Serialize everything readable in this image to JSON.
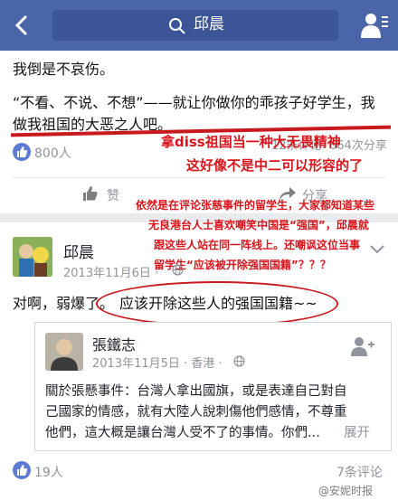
{
  "header": {
    "title": "邱晨"
  },
  "post": {
    "line1": "我倒是不哀伤。",
    "line2": "“不看、不说、不想”——就让你做你的乖孩子好学生，我",
    "line3": "做我祖国的大恶之人吧。",
    "likes": "800人",
    "comments": "12条评论",
    "shares": "664次分享",
    "like_btn": "赞",
    "share_btn": "分享"
  },
  "annotations": {
    "note1": "拿diss祖国当一种大无畏精神",
    "note2": "这好像不是中二可以形容的了",
    "note3_lines": [
      "依然是在评论张慈事件的留学生，大家都知道某些",
      "无良港台人士喜欢嘲笑中国是“强国”，邱晨就",
      "跟这些人站在同一阵线上。还嘲讽这位当事",
      "留学生“应该被开除强国国籍”？？？"
    ]
  },
  "second_post": {
    "author": "邱晨",
    "date": "2013年11月6日 · ",
    "text_prefix": "对啊，弱爆了。",
    "text_circled": "应该开除这些人的强国国籍~~",
    "shared": {
      "author": "張鐵志",
      "date": "2013年11月5日 · 香港 · ",
      "body_lines": [
        "關於張懸事件：台灣人拿出國旗，或是表達自己對自",
        "己國家的情感，就有大陸人說刺傷他們感情，不尊重",
        "他們，這大概是讓台灣人受不了的事情。你們..."
      ],
      "expand": "展开"
    },
    "likes": "19人",
    "comments": "7条评论"
  },
  "watermark": "@安妮时报"
}
